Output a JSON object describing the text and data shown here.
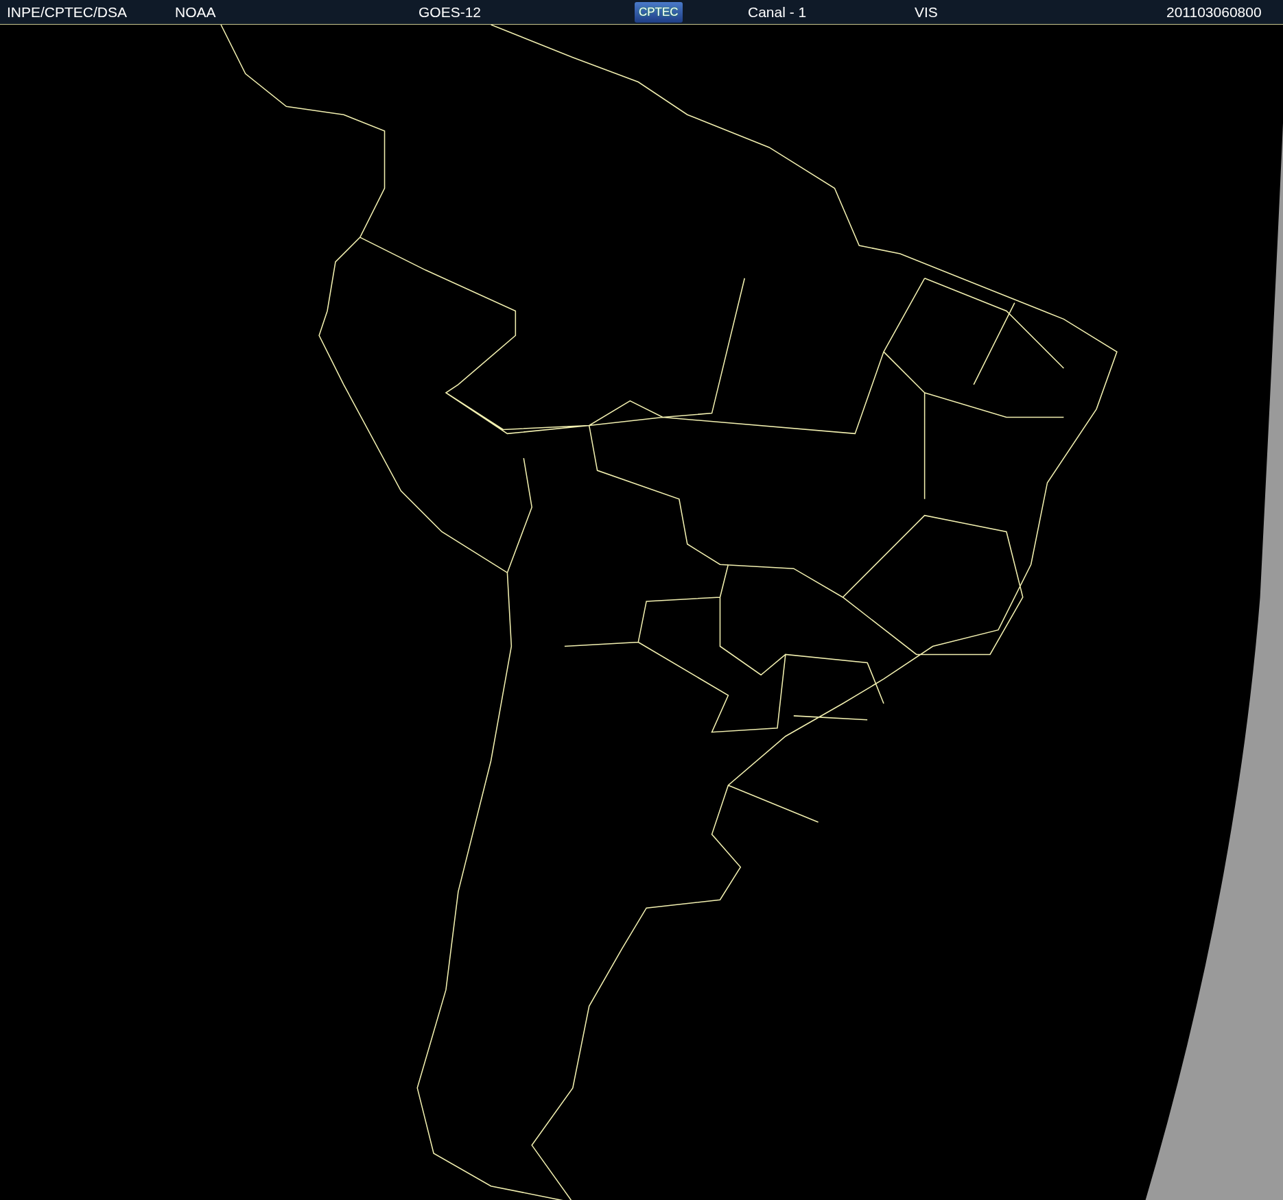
{
  "header": {
    "items": [
      {
        "kind": "text",
        "text": "INPE/CPTEC/DSA"
      },
      {
        "kind": "text",
        "text": "NOAA"
      },
      {
        "kind": "text",
        "text": "GOES-12"
      },
      {
        "kind": "logo",
        "text": "CPTEC"
      },
      {
        "kind": "text",
        "text": "Canal - 1"
      },
      {
        "kind": "text",
        "text": "VIS"
      },
      {
        "kind": "text",
        "text": "201103060800"
      }
    ]
  }
}
